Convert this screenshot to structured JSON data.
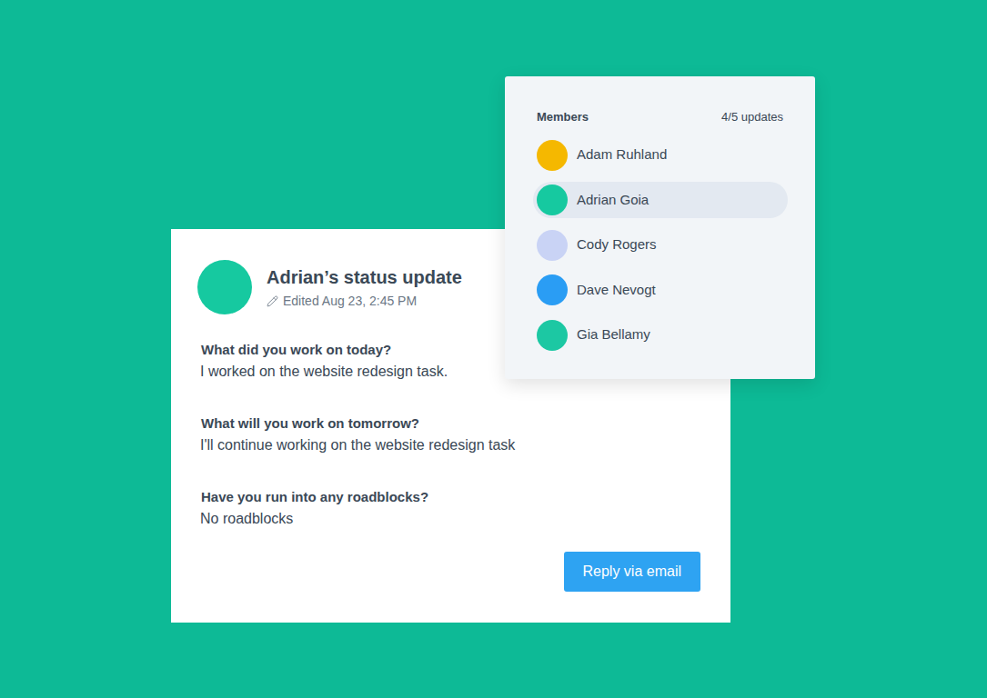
{
  "status_card": {
    "title": "Adrian’s status update",
    "edited": "Edited Aug 23, 2:45 PM",
    "avatar_color": "#16c9a0",
    "questions": [
      {
        "question": "What did you work on today?",
        "answer": "I worked on the website redesign task."
      },
      {
        "question": "What will you work on tomorrow?",
        "answer": "I'll continue working on the website redesign task"
      },
      {
        "question": "Have you run into any roadblocks?",
        "answer": "No roadblocks"
      }
    ],
    "reply_button": "Reply via email"
  },
  "members": {
    "title": "Members",
    "count": "4/5 updates",
    "items": [
      {
        "name": "Adam Ruhland",
        "selected": false,
        "color": "#f5b800"
      },
      {
        "name": "Adrian Goia",
        "selected": true,
        "color": "#16c9a0"
      },
      {
        "name": "Cody Rogers",
        "selected": false,
        "color": "#c9d3f5"
      },
      {
        "name": "Dave Nevogt",
        "selected": false,
        "color": "#2a9df4"
      },
      {
        "name": "Gia Bellamy",
        "selected": false,
        "color": "#1cc8a3"
      }
    ]
  }
}
